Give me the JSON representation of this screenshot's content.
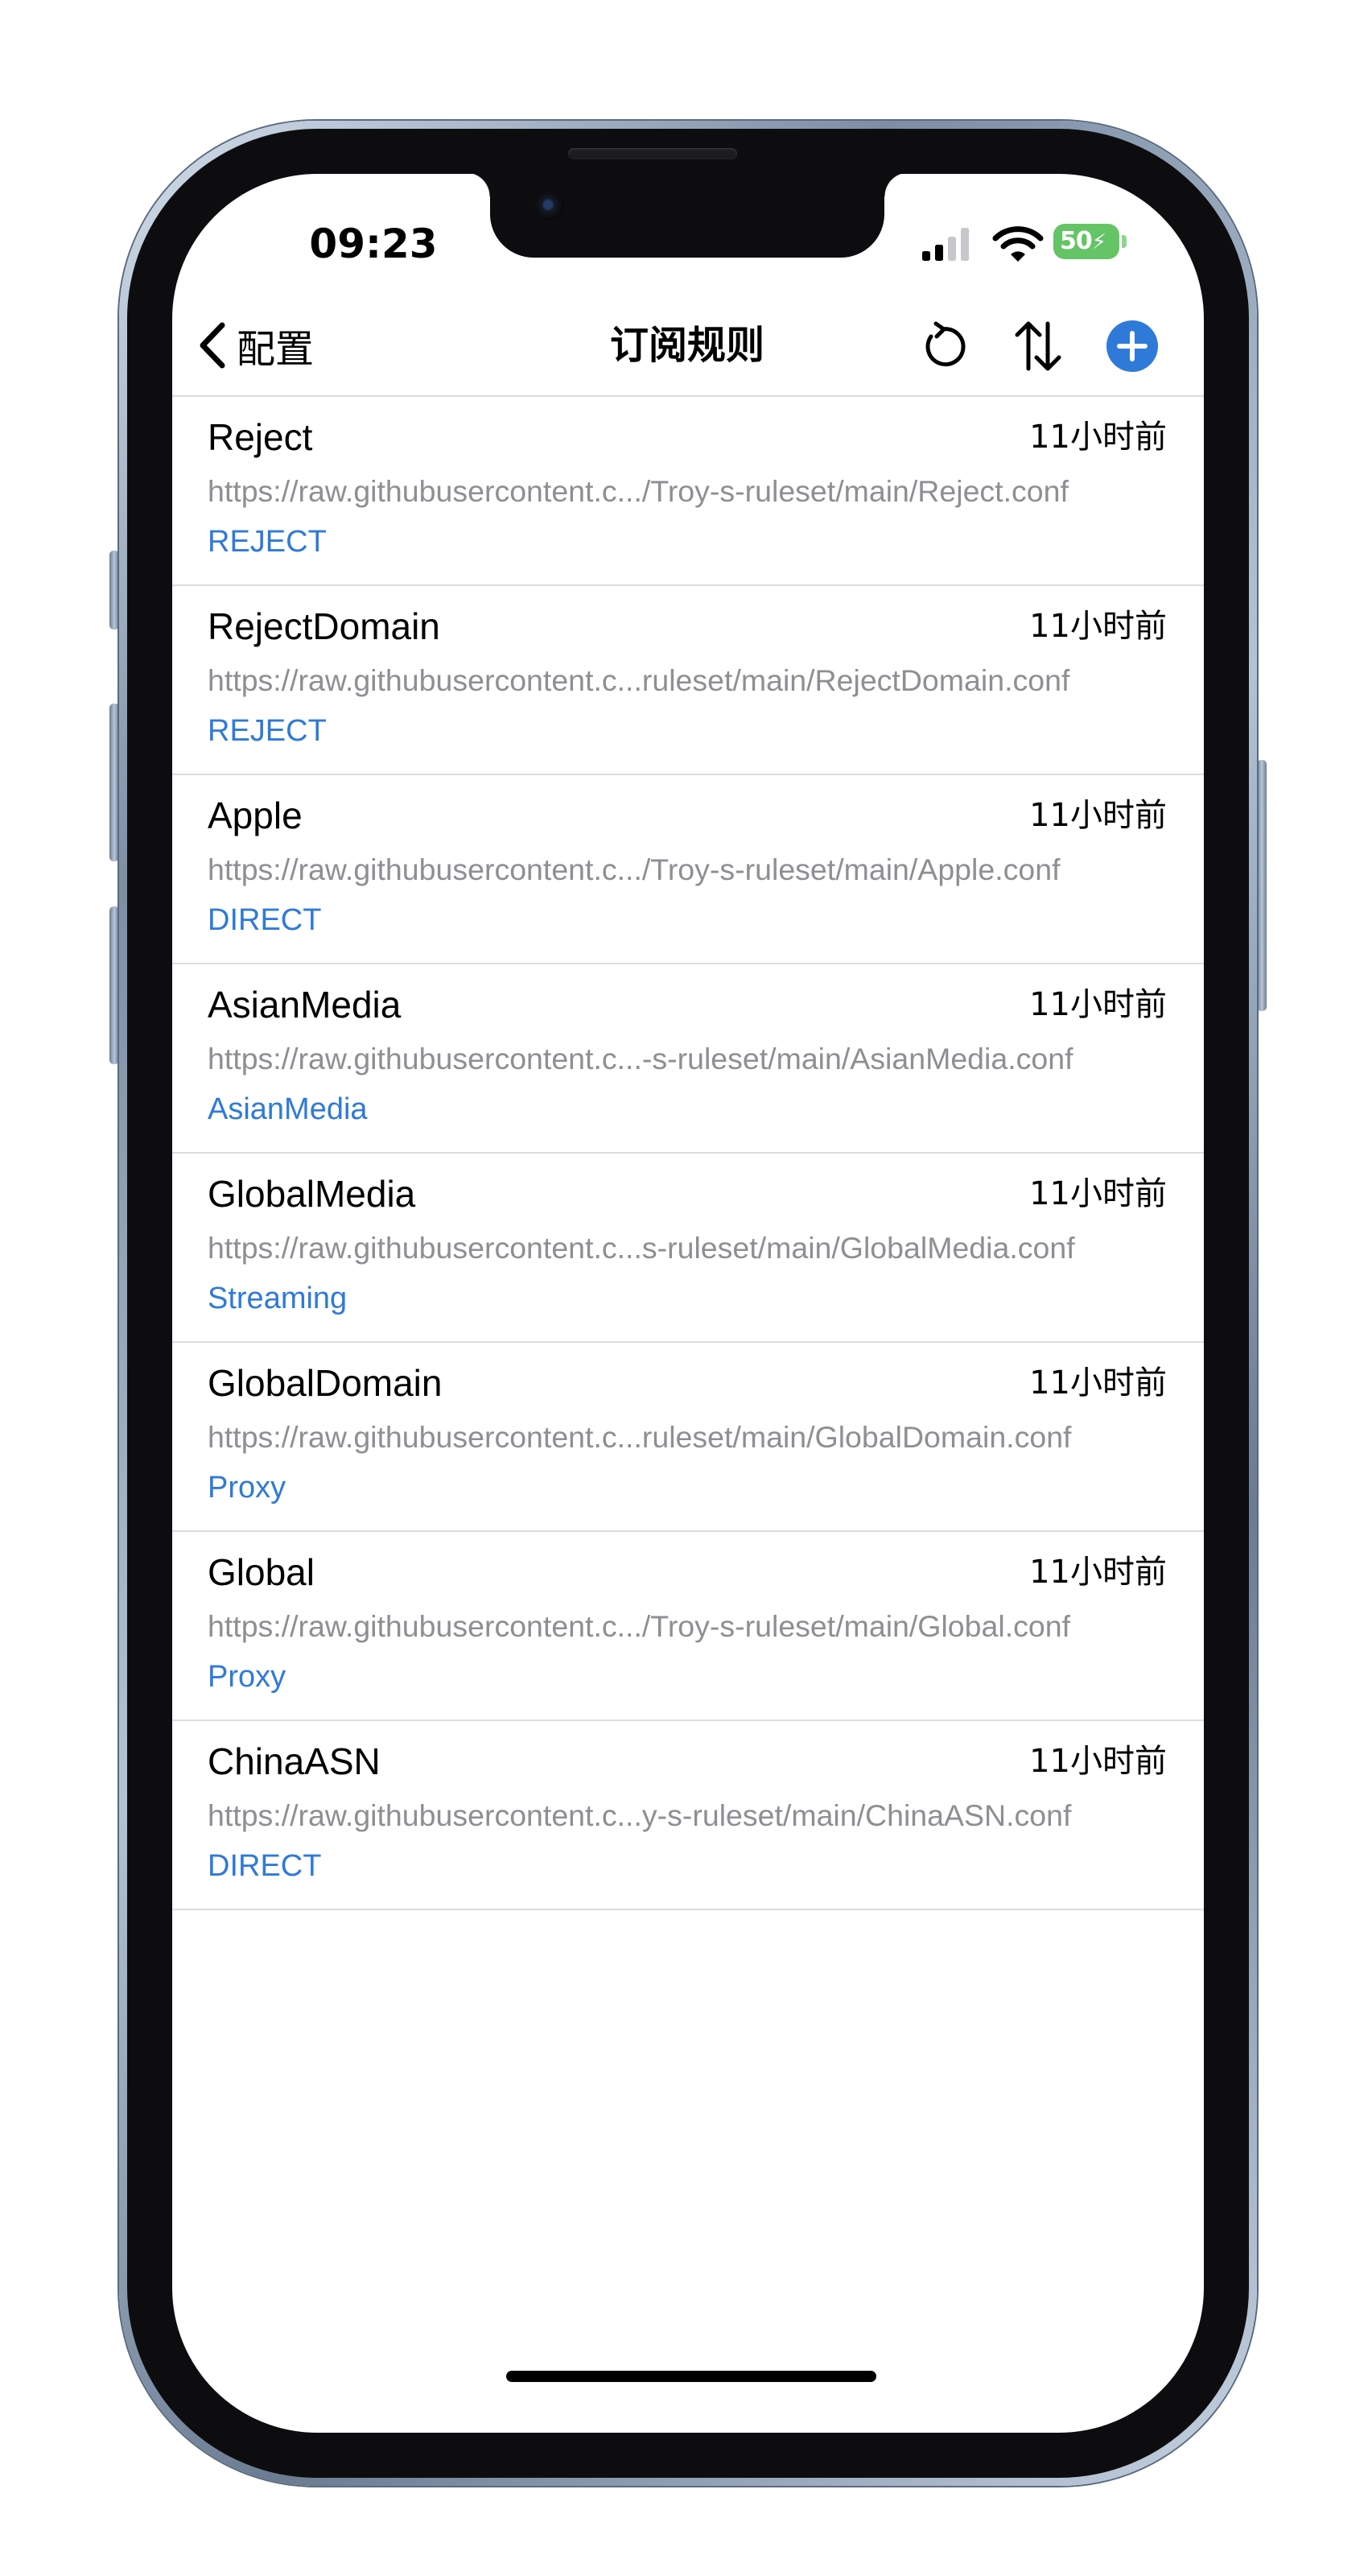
{
  "status_bar": {
    "time": "09:23",
    "battery_level": "50",
    "battery_color": "#65c466",
    "charging": true,
    "icons": [
      "cellular-signal-icon",
      "wifi-icon",
      "battery-charging-icon"
    ]
  },
  "nav": {
    "back_label": "配置",
    "title": "订阅规则",
    "actions": [
      "refresh-icon",
      "sort-icon",
      "add-icon"
    ],
    "add_color": "#2f7ad9"
  },
  "rules": [
    {
      "name": "Reject",
      "time": "11小时前",
      "url": "https://raw.githubusercontent.c.../Troy-s-ruleset/main/Reject.conf",
      "policy": "REJECT"
    },
    {
      "name": "RejectDomain",
      "time": "11小时前",
      "url": "https://raw.githubusercontent.c...ruleset/main/RejectDomain.conf",
      "policy": "REJECT"
    },
    {
      "name": "Apple",
      "time": "11小时前",
      "url": "https://raw.githubusercontent.c.../Troy-s-ruleset/main/Apple.conf",
      "policy": "DIRECT"
    },
    {
      "name": "AsianMedia",
      "time": "11小时前",
      "url": "https://raw.githubusercontent.c...-s-ruleset/main/AsianMedia.conf",
      "policy": "AsianMedia"
    },
    {
      "name": "GlobalMedia",
      "time": "11小时前",
      "url": "https://raw.githubusercontent.c...s-ruleset/main/GlobalMedia.conf",
      "policy": "Streaming"
    },
    {
      "name": "GlobalDomain",
      "time": "11小时前",
      "url": "https://raw.githubusercontent.c...ruleset/main/GlobalDomain.conf",
      "policy": "Proxy"
    },
    {
      "name": "Global",
      "time": "11小时前",
      "url": "https://raw.githubusercontent.c.../Troy-s-ruleset/main/Global.conf",
      "policy": "Proxy"
    },
    {
      "name": "ChinaASN",
      "time": "11小时前",
      "url": "https://raw.githubusercontent.c...y-s-ruleset/main/ChinaASN.conf",
      "policy": "DIRECT"
    }
  ],
  "colors": {
    "policy_text": "#2f7ad9",
    "url_text": "#8e8e93",
    "divider": "#dcdcdf"
  }
}
